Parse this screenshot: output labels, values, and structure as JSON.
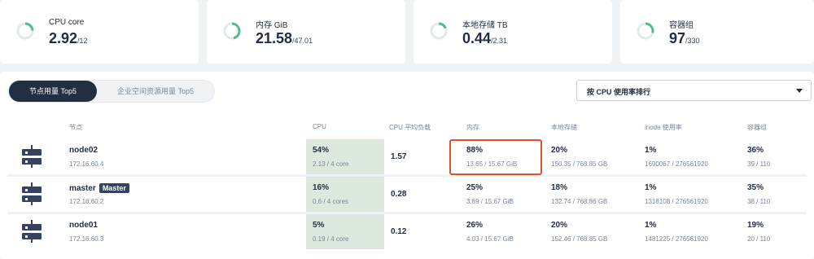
{
  "stats": [
    {
      "label": "CPU core",
      "value": "2.92",
      "total": "/12",
      "fraction": 0.24
    },
    {
      "label": "内存 GiB",
      "value": "21.58",
      "total": "/47.01",
      "fraction": 0.46
    },
    {
      "label": "本地存储 TB",
      "value": "0.44",
      "total": "/2.31",
      "fraction": 0.19
    },
    {
      "label": "容器组",
      "value": "97",
      "total": "/330",
      "fraction": 0.29
    }
  ],
  "tabs": {
    "active": "节点用量 Top5",
    "inactive": "企业空间资源用量 Top5"
  },
  "sort_select": {
    "value": "按 CPU 使用率排行"
  },
  "columns": {
    "node": "节点",
    "cpu": "CPU",
    "cpu_load": "CPU 平均负载",
    "memory": "内存",
    "storage": "本地存储",
    "inode": "inode 使用率",
    "pods": "容器组"
  },
  "rows": [
    {
      "name": "node02",
      "badge": "",
      "ip": "172.16.60.4",
      "cpu": "54%",
      "cpu_sub": "2.13 / 4 core",
      "load": "1.57",
      "mem": "88%",
      "mem_sub": "13.65 / 15.67 GiB",
      "disk": "20%",
      "disk_sub": "150.35 / 768.85 GB",
      "inode": "1%",
      "inode_sub": "1690067 / 276561920",
      "pods": "36%",
      "pods_sub": "39 / 110"
    },
    {
      "name": "master",
      "badge": "Master",
      "ip": "172.16.60.2",
      "cpu": "16%",
      "cpu_sub": "0.6 / 4 cores",
      "load": "0.28",
      "mem": "25%",
      "mem_sub": "3.89 / 15.67 GiB",
      "disk": "18%",
      "disk_sub": "132.74 / 768.86 GB",
      "inode": "1%",
      "inode_sub": "1318108 / 276561920",
      "pods": "35%",
      "pods_sub": "38 / 110"
    },
    {
      "name": "node01",
      "badge": "",
      "ip": "172.16.60.3",
      "cpu": "5%",
      "cpu_sub": "0.19 / 4 core",
      "load": "0.12",
      "mem": "26%",
      "mem_sub": "4.03 / 15.67 GiB",
      "disk": "20%",
      "disk_sub": "152.46 / 768.85 GB",
      "inode": "1%",
      "inode_sub": "1481225 / 276561920",
      "pods": "19%",
      "pods_sub": "20 / 110"
    }
  ],
  "colors": {
    "gauge_fill": "#55bc8a",
    "gauge_track": "#e3e9ef",
    "cpu_cell_bg": "#dde9de",
    "highlight_border": "#e0502f"
  }
}
